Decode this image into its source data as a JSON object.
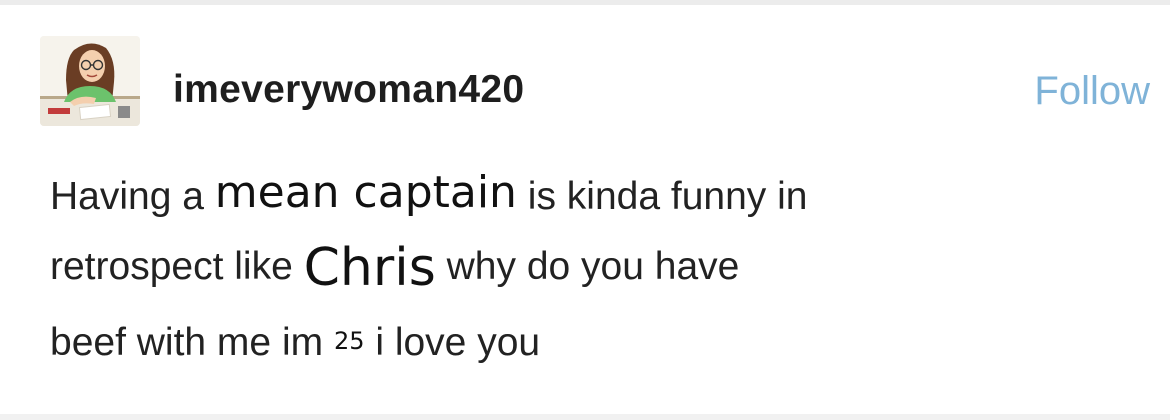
{
  "post": {
    "username": "imeverywoman420",
    "follow_label": "Follow",
    "avatar_icon": "cartoon-woman-avatar-icon",
    "text": {
      "line1_a": "Having a ",
      "line1_b": "mean captain",
      "line1_c": " is kinda funny in",
      "line2_a": "retrospect like ",
      "line2_b": "Chris",
      "line2_c": " why do you have",
      "line3_a": "beef with me im ",
      "line3_b": "25",
      "line3_c": " i love you"
    }
  },
  "colors": {
    "follow": "#7fb3d8",
    "text": "#222222",
    "background": "#ffffff"
  }
}
